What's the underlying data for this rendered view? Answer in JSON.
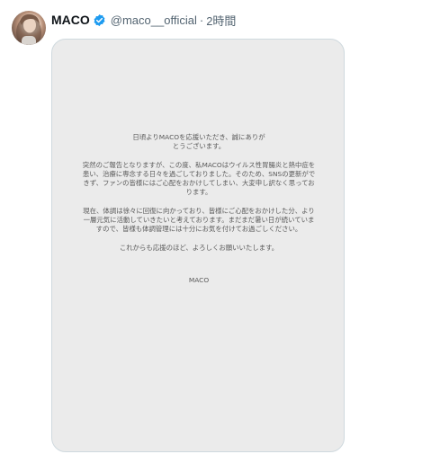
{
  "tweet": {
    "display_name": "MACO",
    "handle": "@maco__official",
    "separator": "·",
    "time": "2時間",
    "verified_icon": "verified-badge-icon",
    "verified_color": "#1d9bf0"
  },
  "notice": {
    "paragraph1": "日頃よりMACOを応援いただき、誠にありがとうございます。",
    "paragraph2": "突然のご報告となりますが、この度、私MACOはウイルス性胃腸炎と熱中症を患い、治療に専念する日々を過ごしておりました。そのため、SNSの更新ができず、ファンの皆様にはご心配をおかけしてしまい、大変申し訳なく思っております。",
    "paragraph3": "現在、体調は徐々に回復に向かっており、皆様にご心配をおかけした分、より一層元気に活動していきたいと考えております。まだまだ暑い日が続いていますので、皆様も体調管理には十分にお気を付けてお過ごしください。",
    "paragraph4": "これからも応援のほど、よろしくお願いいたします。",
    "signature": "MACO"
  }
}
